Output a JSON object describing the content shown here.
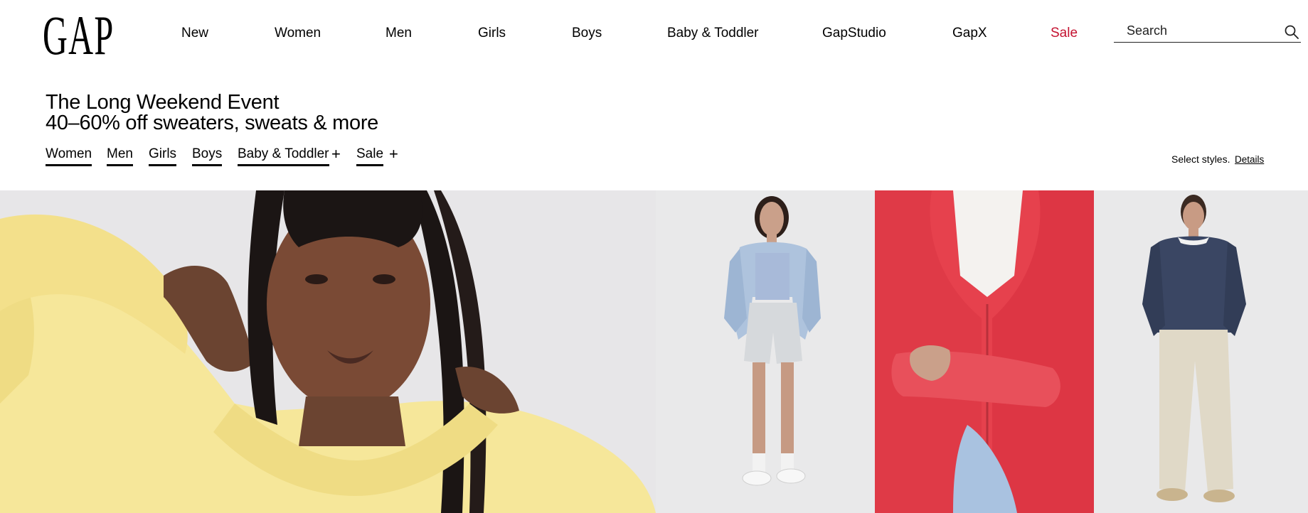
{
  "header": {
    "logo_text": "GAP",
    "nav": [
      {
        "label": "New"
      },
      {
        "label": "Women"
      },
      {
        "label": "Men"
      },
      {
        "label": "Girls"
      },
      {
        "label": "Boys"
      },
      {
        "label": "Baby & Toddler"
      },
      {
        "label": "GapStudio"
      },
      {
        "label": "GapX"
      },
      {
        "label": "Sale"
      }
    ],
    "search": {
      "placeholder": "Search",
      "icon": "search-icon"
    }
  },
  "promo": {
    "title": "The Long Weekend Event",
    "subtitle": "40–60% off sweaters, sweats & more",
    "links": [
      {
        "label": "Women"
      },
      {
        "label": "Men"
      },
      {
        "label": "Girls"
      },
      {
        "label": "Boys"
      },
      {
        "label": "Baby & Toddler"
      },
      {
        "label": "Sale"
      }
    ],
    "expand_symbol": "+",
    "disclaimer": "Select styles.",
    "details_label": "Details"
  },
  "colors": {
    "sale": "#c41230",
    "underline": "#000000",
    "hoodie_yellow": "#f6e79a",
    "jacket_red": "#e6414d",
    "sweater_navy": "#3a4663"
  },
  "hero": {
    "panels": [
      {
        "image": "model-yellow-hoodie-photo"
      },
      {
        "image": "model-denim-jacket-shorts-photo"
      },
      {
        "image": "model-red-zip-hoodie-photo"
      },
      {
        "image": "model-navy-sweatshirt-photo"
      }
    ]
  }
}
